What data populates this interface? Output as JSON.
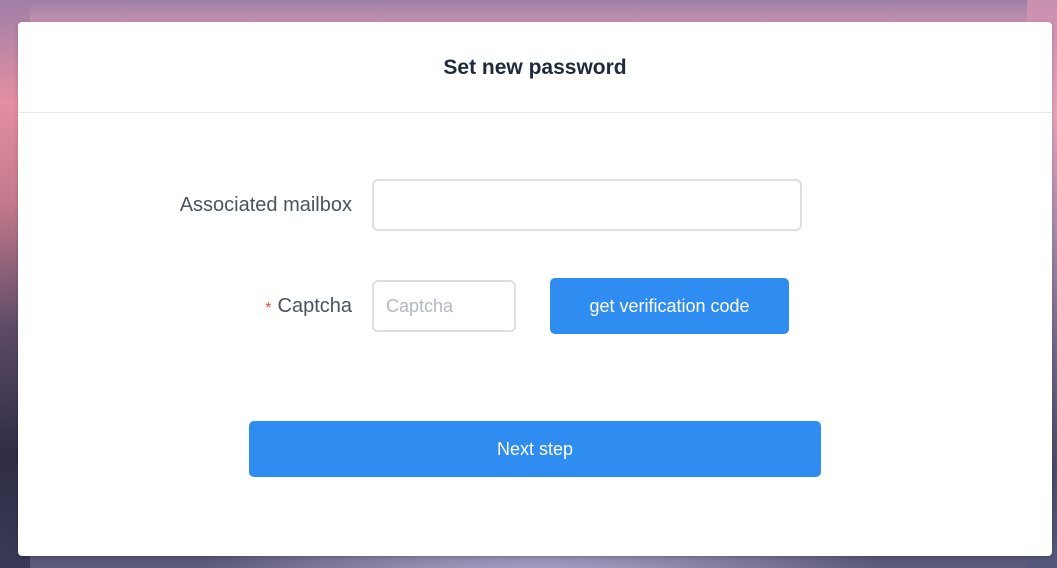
{
  "page": {
    "title": "Set new password"
  },
  "form": {
    "mailbox": {
      "label": "Associated mailbox",
      "value": "",
      "placeholder": ""
    },
    "captcha": {
      "required_mark": "*",
      "label": "Captcha",
      "value": "",
      "placeholder": "Captcha"
    },
    "get_code_label": "get verification code",
    "next_label": "Next step"
  },
  "colors": {
    "primary_button": "#2f8cf0",
    "required_mark": "#e5553f",
    "title_text": "#1f2a3a"
  }
}
